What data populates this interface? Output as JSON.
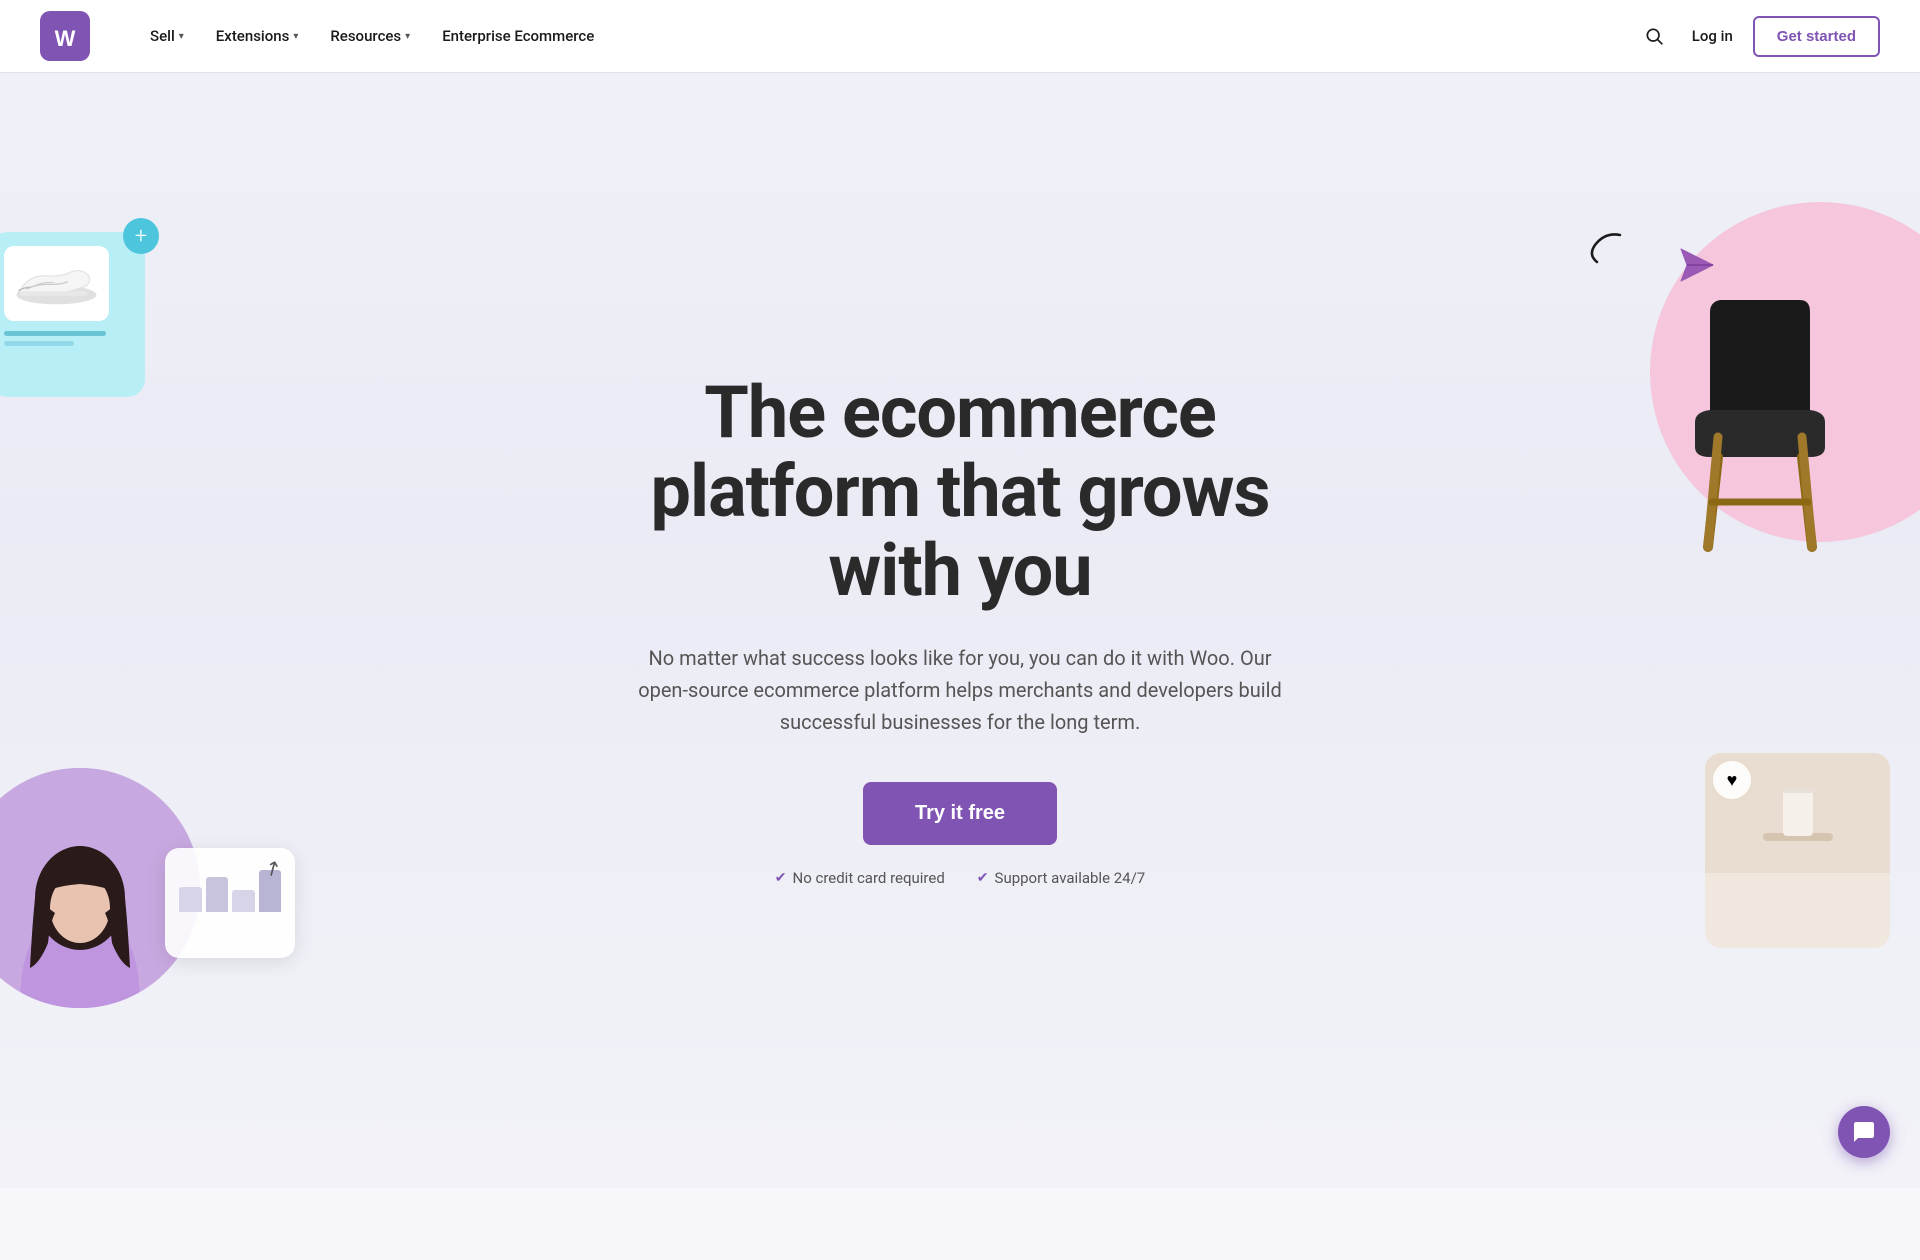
{
  "nav": {
    "logo_alt": "WooCommerce",
    "links": [
      {
        "label": "Sell",
        "has_dropdown": true
      },
      {
        "label": "Extensions",
        "has_dropdown": true
      },
      {
        "label": "Resources",
        "has_dropdown": true
      },
      {
        "label": "Enterprise Ecommerce",
        "has_dropdown": false
      }
    ],
    "login_label": "Log in",
    "get_started_label": "Get started"
  },
  "hero": {
    "title_line1": "The ecommerce",
    "title_line2": "platform that grows",
    "title_line3": "with you",
    "description": "No matter what success looks like for you, you can do it with Woo. Our open-source ecommerce platform helps merchants and developers build successful businesses for the long term.",
    "cta_label": "Try it free",
    "check1": "No credit card required",
    "check2": "Support available 24/7"
  },
  "colors": {
    "brand_purple": "#7f54b3",
    "brand_teal": "#4dc5dd",
    "deco_pink": "#f5c6dc",
    "deco_blue": "#b8eef5"
  },
  "icons": {
    "search": "🔍",
    "check": "✓",
    "plus": "+",
    "chat": "💬",
    "heart": "♥",
    "plane": "▷"
  }
}
